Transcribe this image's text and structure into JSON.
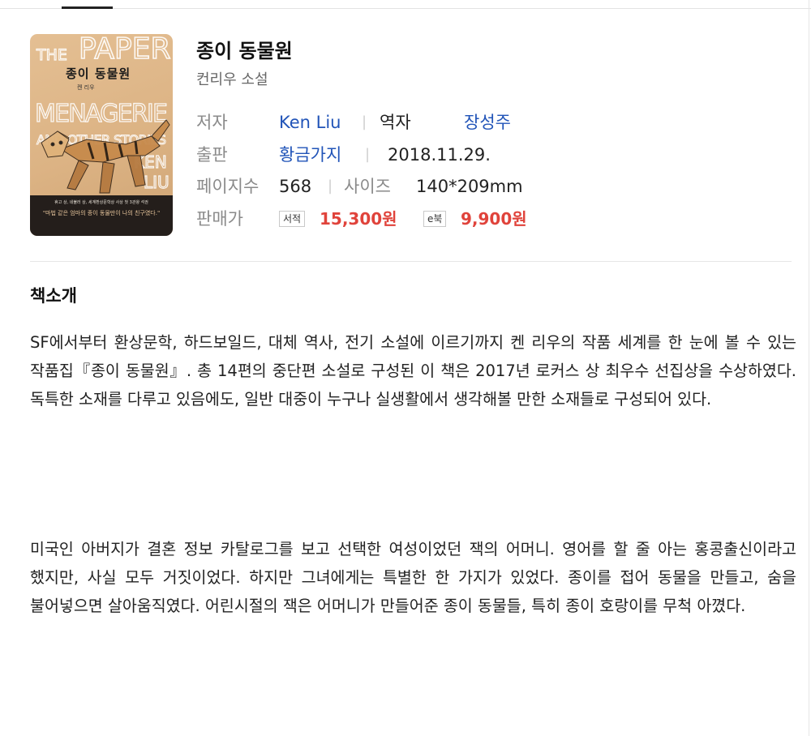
{
  "book": {
    "title": "종이 동물원",
    "subtitle": "컨리우 소설",
    "cover": {
      "art_text": [
        "THE",
        "PAPER",
        "MENAGERIE",
        "AND OTHER STORIES",
        "KEN",
        "LIU"
      ],
      "title": "종이 동물원",
      "author": "켄 리우",
      "blurb": "휴고 상, 네뷸러 상, 세계환상문학상 사상 첫 3관왕 석권",
      "quote": "\"마법 같은 엄마의 종이 동물만이 나의 친구였다.\"",
      "color": "#dcb384"
    }
  },
  "meta": {
    "author_label": "저자",
    "author": "Ken Liu",
    "translator_label": "역자",
    "translator": "장성주",
    "publisher_label": "출판",
    "publisher": "황금가지",
    "pub_date": "2018.11.29.",
    "pages_label": "페이지수",
    "pages": "568",
    "size_label": "사이즈",
    "size": "140*209mm",
    "price_label": "판매가",
    "print_tag": "서적",
    "print_price": "15,300원",
    "ebook_tag": "e북",
    "ebook_price": "9,900원",
    "price_color": "#e0433b",
    "link_color": "#2154b8",
    "separator": "|"
  },
  "intro": {
    "heading": "책소개",
    "paragraphs": [
      "SF에서부터 환상문학, 하드보일드, 대체 역사, 전기 소설에 이르기까지 켄 리우의 작품 세계를 한 눈에 볼 수 있는 작품집『종이 동물원』. 총 14편의 중단편 소설로 구성된 이 책은 2017년 로커스 상 최우수 선집상을 수상하였다. 독특한 소재를 다루고 있음에도, 일반 대중이 누구나 실생활에서 생각해볼 만한 소재들로 구성되어 있다.",
      "미국인 아버지가 결혼 정보 카탈로그를 보고 선택한 여성이었던 잭의 어머니. 영어를 할 줄 아는 홍콩출신이라고 했지만, 사실 모두 거짓이었다. 하지만 그녀에게는 특별한 한 가지가 있었다. 종이를 접어 동물을 만들고, 숨을 불어넣으면 살아움직였다. 어린시절의 잭은 어머니가 만들어준 종이 동물들, 특히 종이 호랑이를 무척 아꼈다."
    ]
  }
}
